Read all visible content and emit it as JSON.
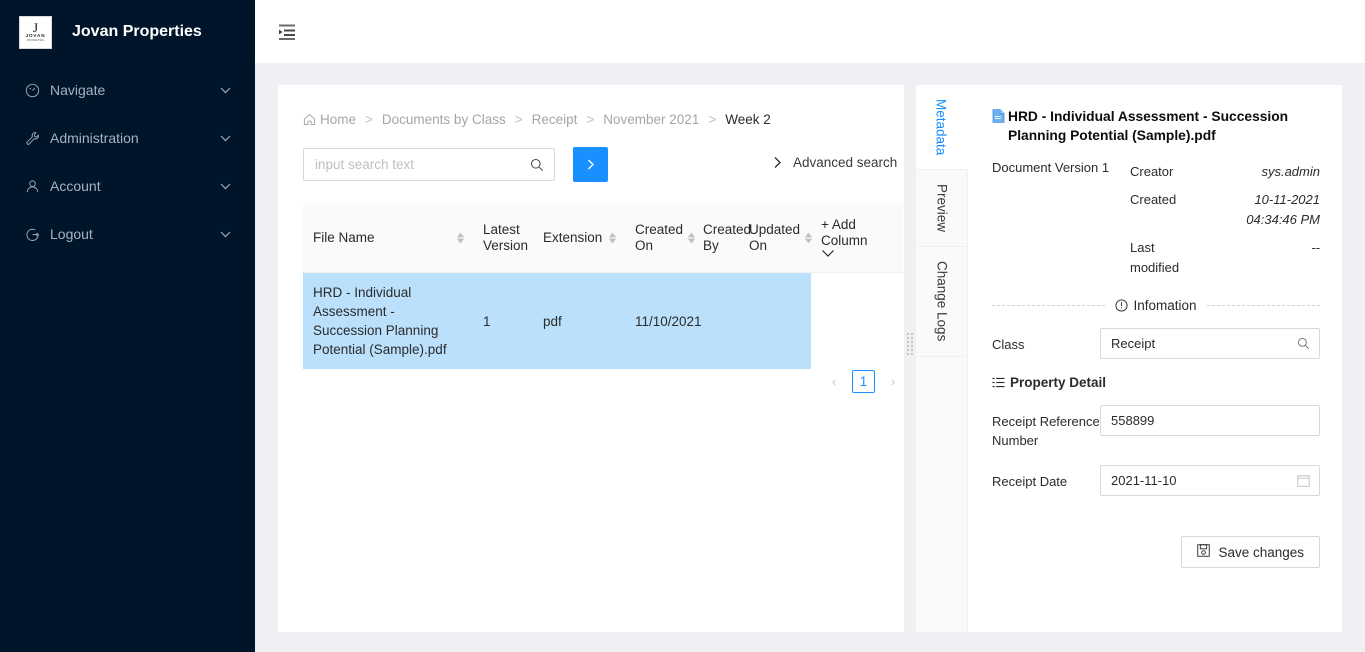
{
  "sidebar": {
    "brand": {
      "title": "Jovan Properties",
      "logo_letter": "J",
      "logo_name": "JOVAN",
      "logo_sub": "PROPERTIES"
    },
    "items": [
      {
        "label": "Navigate",
        "icon": "dashboard-icon"
      },
      {
        "label": "Administration",
        "icon": "tool-icon"
      },
      {
        "label": "Account",
        "icon": "user-icon"
      },
      {
        "label": "Logout",
        "icon": "logout-icon"
      }
    ]
  },
  "header": {
    "fold_icon": "menu-fold-icon"
  },
  "breadcrumb": {
    "home": "Home",
    "items": [
      "Documents by Class",
      "Receipt",
      "November 2021"
    ],
    "current": "Week 2",
    "separator": ">"
  },
  "search": {
    "placeholder": "input search text",
    "value": "",
    "go_label": ">",
    "advanced_label": "Advanced search"
  },
  "table": {
    "columns": [
      {
        "label": "File Name",
        "sortable": true
      },
      {
        "label": "Latest Version",
        "sortable": false
      },
      {
        "label": "Extension",
        "sortable": true
      },
      {
        "label": "Created On",
        "sortable": true
      },
      {
        "label": "Created By",
        "sortable": false
      },
      {
        "label": "Updated On",
        "sortable": true
      }
    ],
    "add_column_label": "+ Add Column",
    "rows": [
      {
        "file_name": "HRD - Individual Assessment - Succession Planning Potential (Sample).pdf",
        "latest_version": "1",
        "extension": "pdf",
        "created_on": "11/10/2021",
        "created_by": "",
        "updated_on": "",
        "selected": true
      }
    ]
  },
  "pagination": {
    "prev": "‹",
    "page": "1",
    "next": "›"
  },
  "vtabs": [
    {
      "label": "Metadata",
      "active": true
    },
    {
      "label": "Preview",
      "active": false
    },
    {
      "label": "Change Logs",
      "active": false
    }
  ],
  "detail": {
    "doc_title": "HRD - Individual Assessment - Succession Planning Potential (Sample).pdf",
    "document_version": "Document Version 1",
    "meta": [
      {
        "key": "Creator",
        "value": "sys.admin"
      },
      {
        "key": "Created",
        "value": "10-11-2021 04:34:46 PM"
      },
      {
        "key": "Last modified",
        "value": "--"
      }
    ],
    "info_divider_label": "Infomation",
    "class_label": "Class",
    "class_value": "Receipt",
    "property_detail_label": "Property Detail",
    "fields": [
      {
        "label": "Receipt Reference Number",
        "value": "558899",
        "type": "text"
      },
      {
        "label": "Receipt Date",
        "value": "2021-11-10",
        "type": "date"
      }
    ],
    "save_label": "Save changes"
  },
  "colors": {
    "sidebar_bg": "#001529",
    "accent": "#1890ff",
    "row_selected": "#bae0fc",
    "content_bg": "#eff0f4",
    "table_header_bg": "#fafafa"
  }
}
